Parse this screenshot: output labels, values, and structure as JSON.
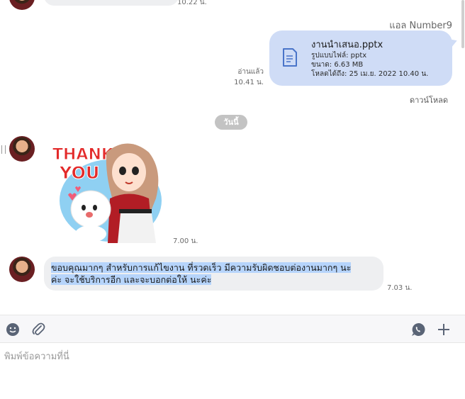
{
  "chat": {
    "top_partial_time": "10.22 น.",
    "sender_name": "แอล Number9",
    "file": {
      "name": "งานนำเสนอ.pptx",
      "format_line": "รูปแบบไฟล์: pptx",
      "size_line": "ขนาด: 6.63 MB",
      "expiry_line": "โหลดได้ถึง: 25 เม.ย. 2022 10.40 น."
    },
    "read_status": "อ่านแล้ว",
    "read_time": "10.41 น.",
    "download_label": "ดาวน์โหลด",
    "date_divider": "วันนี้",
    "sticker_time": "7.00 น.",
    "message": {
      "line1": "ขอบคุณมากๆ สำหรับการแก้ไขงาน ที่รวดเร็ว มีความรับผิดชอบต่องานมากๆ นะ",
      "line2": "ค่ะ จะใช้บริการอีก และจะบอกต่อให้ นะค่ะ",
      "time": "7.03 น."
    },
    "sticker_text": "THANK YOU"
  },
  "toolbar": {
    "emoji_icon": "emoji-icon",
    "attach_icon": "paperclip-icon",
    "voice_icon": "voice-call-icon",
    "add_icon": "plus-icon"
  },
  "input": {
    "placeholder": "พิมพ์ข้อความที่นี่"
  },
  "colors": {
    "outgoing_bubble": "#cfdcf6",
    "incoming_bubble": "#eeeff1",
    "selection": "#b6d4fb"
  }
}
